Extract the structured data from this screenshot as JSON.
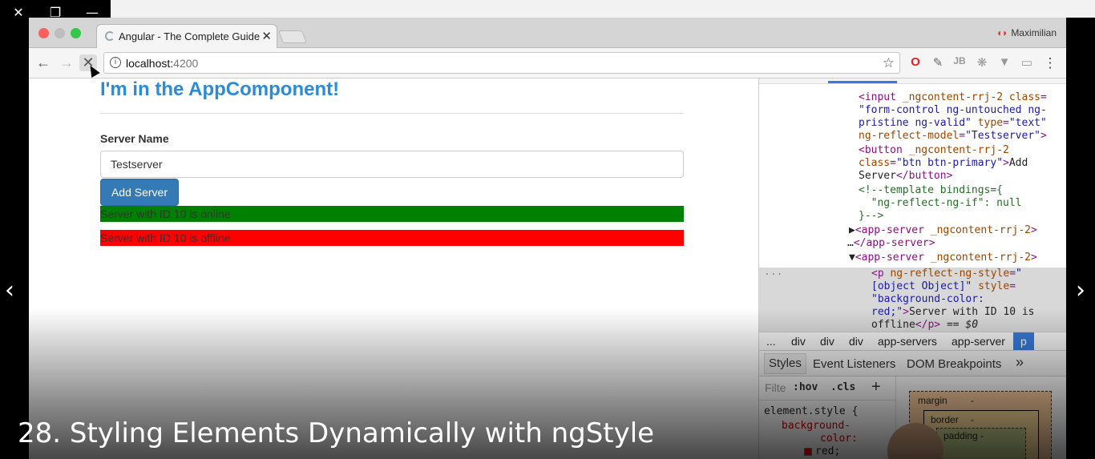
{
  "player": {
    "close_icon": "✕",
    "restore_icon": "❐",
    "minimize_icon": "—",
    "prev_icon": "‹",
    "next_icon": "›",
    "caption": "28. Styling Elements Dynamically with ngStyle"
  },
  "browser": {
    "tab_title": "Angular - The Complete Guide",
    "tab_close": "✕",
    "profile_name": "Maximilian",
    "url_host": "localhost:",
    "url_port": "4200",
    "back_icon": "←",
    "forward_icon": "→",
    "stop_icon": "✕",
    "star_icon": "☆",
    "menu_icon": "⋮",
    "colors": {
      "close": "#fc605c",
      "minimize": "#fdbc40",
      "maximize": "#34c84a"
    }
  },
  "page": {
    "heading": "I'm in the AppComponent!",
    "server_name_label": "Server Name",
    "server_name_value": "Testserver",
    "add_server_label": "Add Server",
    "servers": [
      {
        "text": "Server with ID 10 is online",
        "color": "#008000"
      },
      {
        "text": "Server with ID 10 is offline",
        "color": "#ff0000"
      }
    ]
  },
  "devtools": {
    "breadcrumbs": [
      "...",
      "div",
      "div",
      "div",
      "app-servers",
      "app-server",
      "p"
    ],
    "tabs": [
      "Styles",
      "Event Listeners",
      "DOM Breakpoints",
      "»"
    ],
    "filter_placeholder": "Filte",
    "hov": ":hov",
    "cls": ".cls",
    "plus": "+",
    "style_rule": "element.style {",
    "style_prop": "background-",
    "style_prop2": "color:",
    "style_val": "red;",
    "box_margin": "margin",
    "box_border": "border",
    "box_padding": "padding -",
    "dash": "-"
  }
}
